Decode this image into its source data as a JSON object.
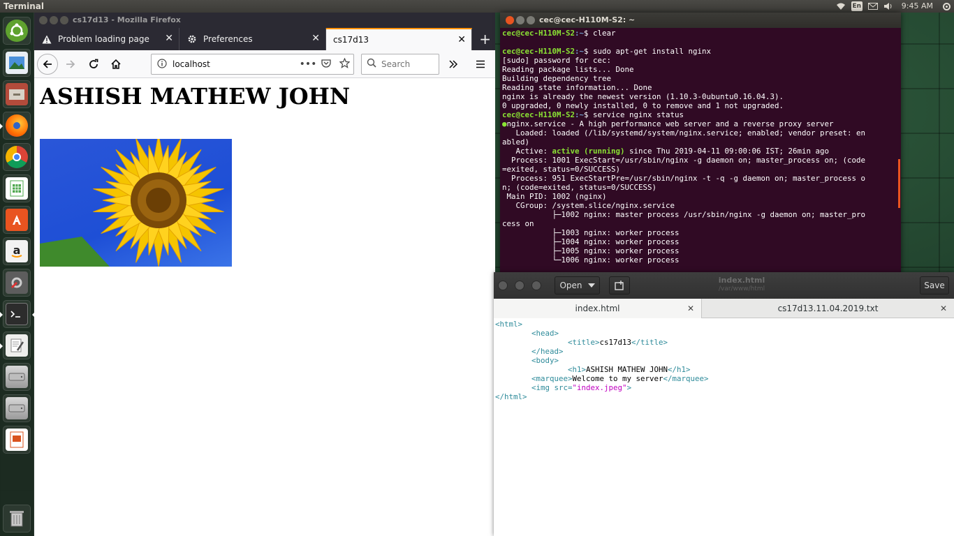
{
  "top_panel": {
    "app_title": "Terminal",
    "lang": "En",
    "clock": "9:45 AM",
    "icons": [
      "wifi-icon",
      "keyboard-layout-icon",
      "mail-icon",
      "volume-icon",
      "power-gear-icon"
    ]
  },
  "launcher": {
    "items": [
      "ubuntu-dash",
      "files",
      "file-manager",
      "firefox",
      "chrome",
      "libreoffice-calc",
      "software-center",
      "amazon",
      "system-settings",
      "terminal",
      "text-editor",
      "disk-drive-1",
      "disk-drive-2",
      "libreoffice-impress",
      "trash"
    ]
  },
  "firefox": {
    "window_title": "cs17d13 - Mozilla Firefox",
    "tabs": [
      {
        "label": "Problem loading page",
        "icon": "warning-icon"
      },
      {
        "label": "Preferences",
        "icon": "gear-icon"
      },
      {
        "label": "cs17d13",
        "icon": ""
      }
    ],
    "url": "localhost",
    "search_placeholder": "Search",
    "page_heading": "ASHISH MATHEW JOHN"
  },
  "terminal": {
    "window_title": "cec@cec-H110M-S2: ~",
    "prompt_user": "cec@cec-H110M-S2",
    "prompt_path": ":~",
    "lines": [
      {
        "type": "prompt",
        "cmd": "$ clear"
      },
      {
        "type": "blank",
        "text": ""
      },
      {
        "type": "prompt",
        "cmd": "$ sudo apt-get install nginx"
      },
      {
        "type": "text",
        "text": "[sudo] password for cec:"
      },
      {
        "type": "text",
        "text": "Reading package lists... Done"
      },
      {
        "type": "text",
        "text": "Building dependency tree"
      },
      {
        "type": "text",
        "text": "Reading state information... Done"
      },
      {
        "type": "text",
        "text": "nginx is already the newest version (1.10.3-0ubuntu0.16.04.3)."
      },
      {
        "type": "text",
        "text": "0 upgraded, 0 newly installed, 0 to remove and 1 not upgraded."
      },
      {
        "type": "prompt",
        "cmd": "$ service nginx status"
      },
      {
        "type": "status",
        "text": "nginx.service - A high performance web server and a reverse proxy server"
      },
      {
        "type": "text",
        "text": "   Loaded: loaded (/lib/systemd/system/nginx.service; enabled; vendor preset: en"
      },
      {
        "type": "text",
        "text": "abled)"
      },
      {
        "type": "active",
        "pre": "   Active: ",
        "hl": "active (running)",
        "post": " since Thu 2019-04-11 09:00:06 IST; 26min ago"
      },
      {
        "type": "text",
        "text": "  Process: 1001 ExecStart=/usr/sbin/nginx -g daemon on; master_process on; (code"
      },
      {
        "type": "text",
        "text": "=exited, status=0/SUCCESS)"
      },
      {
        "type": "text",
        "text": "  Process: 951 ExecStartPre=/usr/sbin/nginx -t -q -g daemon on; master_process o"
      },
      {
        "type": "text",
        "text": "n; (code=exited, status=0/SUCCESS)"
      },
      {
        "type": "text",
        "text": " Main PID: 1002 (nginx)"
      },
      {
        "type": "text",
        "text": "   CGroup: /system.slice/nginx.service"
      },
      {
        "type": "text",
        "text": "           ├─1002 nginx: master process /usr/sbin/nginx -g daemon on; master_pro"
      },
      {
        "type": "text",
        "text": "cess on"
      },
      {
        "type": "text",
        "text": "           ├─1003 nginx: worker process"
      },
      {
        "type": "text",
        "text": "           ├─1004 nginx: worker process"
      },
      {
        "type": "text",
        "text": "           ├─1005 nginx: worker process"
      },
      {
        "type": "text",
        "text": "           └─1006 nginx: worker process"
      }
    ]
  },
  "gedit": {
    "open_label": "Open",
    "save_label": "Save",
    "title": "index.html",
    "subtitle": "/var/www/html",
    "tabs": [
      {
        "label": "index.html"
      },
      {
        "label": "cs17d13.11.04.2019.txt"
      }
    ],
    "code_lines": [
      {
        "indent": "",
        "parts": [
          [
            "tag",
            "<html>"
          ]
        ]
      },
      {
        "indent": "        ",
        "parts": [
          [
            "tag",
            "<head>"
          ]
        ]
      },
      {
        "indent": "                ",
        "parts": [
          [
            "tag",
            "<title>"
          ],
          [
            "text",
            "cs17d13"
          ],
          [
            "tag",
            "</title>"
          ]
        ]
      },
      {
        "indent": "        ",
        "parts": [
          [
            "tag",
            "</head>"
          ]
        ]
      },
      {
        "indent": "        ",
        "parts": [
          [
            "tag",
            "<body>"
          ]
        ]
      },
      {
        "indent": "                ",
        "parts": [
          [
            "tag",
            "<h1>"
          ],
          [
            "text",
            "ASHISH MATHEW JOHN"
          ],
          [
            "tag",
            "</h1>"
          ]
        ]
      },
      {
        "indent": "        ",
        "parts": [
          [
            "tag",
            "<marquee>"
          ],
          [
            "text",
            "Welcome to my server"
          ],
          [
            "tag",
            "</marquee>"
          ]
        ]
      },
      {
        "indent": "        ",
        "parts": [
          [
            "tag",
            "<img "
          ],
          [
            "attr",
            "src="
          ],
          [
            "str",
            "\"index.jpeg\""
          ],
          [
            "tag",
            ">"
          ]
        ]
      },
      {
        "indent": "",
        "parts": [
          [
            "tag",
            "</html>"
          ]
        ]
      }
    ]
  }
}
